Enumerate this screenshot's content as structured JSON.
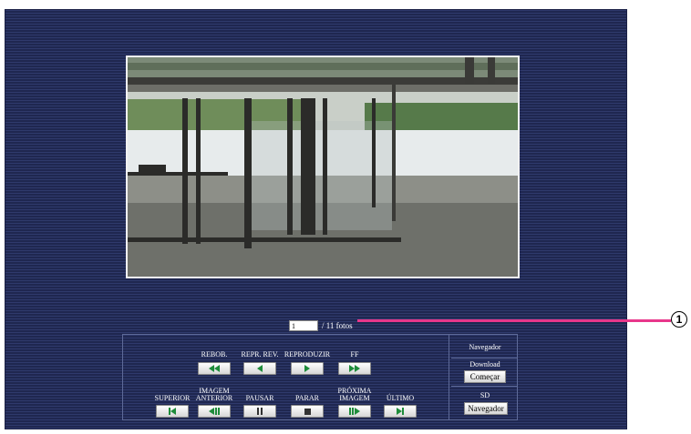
{
  "paging": {
    "current_page": "1",
    "total_text": "/ 11 fotos"
  },
  "playback": {
    "row1": [
      {
        "label": "REBOB.",
        "icon": "rewind-icon"
      },
      {
        "label": "REPR. REV.",
        "icon": "play-reverse-icon"
      },
      {
        "label": "REPRODUZIR",
        "icon": "play-icon"
      },
      {
        "label": "FF",
        "icon": "fast-forward-icon"
      }
    ],
    "row2": [
      {
        "label": "SUPERIOR",
        "icon": "skip-first-icon"
      },
      {
        "label": "IMAGEM\nANTERIOR",
        "icon": "previous-frame-icon"
      },
      {
        "label": "PAUSAR",
        "icon": "pause-icon"
      },
      {
        "label": "PARAR",
        "icon": "stop-icon"
      },
      {
        "label": "PRÓXIMA\nIMAGEM",
        "icon": "next-frame-icon"
      },
      {
        "label": "ÚLTIMO",
        "icon": "skip-last-icon"
      }
    ]
  },
  "navigator": {
    "title": "Navegador",
    "download_label": "Download",
    "download_button": "Começar",
    "sd_label": "SD",
    "sd_button": "Navegador"
  },
  "callout": {
    "number": "1"
  },
  "colors": {
    "panel": "#27305c",
    "icon_green": "#1e8c3a",
    "callout": "#e8378b"
  }
}
